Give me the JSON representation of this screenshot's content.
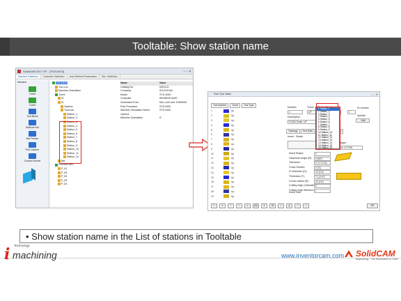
{
  "slide": {
    "title": "Tooltable: Show station name",
    "note": "Show station name in the List of stations in Tooltable",
    "website": "www.inventorcam.com",
    "colors": {
      "title_bar": "#4a4a4a",
      "highlight_box": "#e21d1d",
      "arrow_outline": "#d6241c"
    }
  },
  "left_window": {
    "title": "SolidCAM 2017 SP - [TOOLBOX]",
    "tabs": [
      "Machine Definition",
      "Controller Definition",
      "User Defined Parameters",
      "Sim. Definition"
    ],
    "pane_title": "Machine",
    "pane_items": [
      "Turret",
      "Turret",
      "Tool Block",
      "Stations Info",
      "Bar Feeder",
      "Part Catcher",
      "Custom Device"
    ],
    "tree": [
      "TOOLBOX",
      "Tool Loc.",
      "Machine Orientation",
      "Turret",
      "PL",
      "SI",
      "Options",
      "ToolLocs",
      "Station_1",
      "Station_2",
      "Station_3",
      "Station_4",
      "Station_5",
      "Station_6",
      "Station_7",
      "Station_8",
      "Station_9",
      "Station_10",
      "Station_11",
      "Station_12",
      "Bar",
      "Connect Item",
      "P_61",
      "P_65",
      "P_64",
      "P_63",
      "P_62",
      "P_61"
    ],
    "props_header": [
      "Name",
      "Value"
    ],
    "props": [
      [
        "Catalog No.",
        "MXD211"
      ],
      [
        "Company",
        "SOLIDCAM"
      ],
      [
        "Model",
        "STD-0000"
      ],
      [
        "Controller",
        "SIEMENS 840D"
      ],
      [
        "Generated From",
        "MILL-640 and TURNING"
      ],
      [
        "Post Processor",
        "STD-0000"
      ],
      [
        "Machine Simulation Name",
        "STD-0000"
      ],
      [
        "Options",
        ""
      ],
      [
        "Machine Orientation",
        "0°"
      ]
    ]
  },
  "right_window": {
    "title": "Part Tool Table",
    "header_tabs": [
      "Tool Number",
      "Turret",
      "Tool Type"
    ],
    "tool_rows": [
      {
        "num": "1",
        "turret": "Up",
        "color": "#2b2bd1"
      },
      {
        "num": "2",
        "turret": "Up",
        "color": "#d8c21c"
      },
      {
        "num": "3",
        "turret": "Up",
        "color": "#e8c52a"
      },
      {
        "num": "4",
        "turret": "Up",
        "color": "#2a2ad0"
      },
      {
        "num": "5",
        "turret": "Up",
        "color": "#d9b516"
      },
      {
        "num": "6",
        "turret": "Up",
        "color": "#34319f"
      },
      {
        "num": "7",
        "turret": "Up",
        "color": "#d7b11c"
      },
      {
        "num": "8",
        "turret": "Up",
        "color": "#e0b71f"
      },
      {
        "num": "9",
        "turret": "Up",
        "color": "#2b2a9f"
      },
      {
        "num": "10",
        "turret": "Up",
        "color": "#cfa717"
      },
      {
        "num": "11",
        "turret": "Up",
        "color": "#e2c12a"
      },
      {
        "num": "12",
        "turret": "Up",
        "color": "#d7b21c"
      },
      {
        "num": "13",
        "turret": "Up",
        "color": "#2929a8"
      },
      {
        "num": "14",
        "turret": "Up",
        "color": "#e8c52a"
      },
      {
        "num": "15",
        "turret": "Up",
        "color": "#2a2ad0"
      },
      {
        "num": "16",
        "turret": "Up",
        "color": "#d9b516"
      },
      {
        "num": "17",
        "turret": "Up",
        "color": "#e0b71f"
      },
      {
        "num": "18",
        "turret": "Up",
        "color": "#3535a0"
      },
      {
        "num": "19",
        "turret": "Up",
        "color": "#d5b01c"
      }
    ],
    "form": {
      "number_label": "Number",
      "number_value": "1",
      "turret_label": "Turret",
      "turret_value": "UP",
      "description_label": "Description",
      "description_value": "S1264 Scale: UP",
      "station_label": "Station Position",
      "station_value": "1 Station_1",
      "id_label": "ID number",
      "id_value": "1",
      "spindle_label": "Spindle",
      "edit_label": "Edit",
      "tabs": [
        "Topology",
        "Tool Data",
        "Holder",
        "Holder Geo"
      ],
      "insert_label": "Insert",
      "shank_label": "Shank",
      "params": [
        [
          "Insert Shape:",
          "C"
        ],
        [
          "Clearance angle (B):",
          "5 (80°)"
        ],
        [
          "Tolerance:",
          "G (+/-0.13)"
        ],
        [
          "Cross Section:",
          "X (S)"
        ],
        [
          "IC Diameter (D):",
          "12 (0.3)"
        ],
        [
          "Thickness (T):",
          "T1 (3.97)"
        ],
        [
          "Corner radius (R):",
          "04 (0.4)"
        ],
        [
          "Cutting edge (Inclination):",
          "E"
        ],
        [
          "Cutting edge direction:",
          "L"
        ]
      ],
      "check_label": "Insert view",
      "cat_label": "Catalogue",
      "cat_value": "Check: 1C7004"
    },
    "station_options": [
      "1 Station_1",
      "2 Station_2",
      "3 Station_3",
      "4 Station_4",
      "5 Station_5",
      "6 Station_6",
      "7 Station_7",
      "8 Station_8",
      "9 Station_9",
      "10 Station_10",
      "11 Station_11",
      "12 Station_12",
      "13 Station_13",
      "14 Station_14",
      "15 Station_15",
      "16 Station_16"
    ],
    "selected_station": "1 Station_1",
    "bottom_buttons": [
      "+",
      "x",
      "*",
      "^",
      "v",
      "[A]",
      "X",
      "M",
      "=",
      "||",
      "?",
      "i"
    ],
    "ok_label": "OK"
  },
  "logos": {
    "imachining": {
      "super": "Technology",
      "i": "i",
      "rest": "machining"
    },
    "solidcam": {
      "name": "SolidCAM",
      "tagline": "iMachining - The Revolution in CAM"
    }
  }
}
